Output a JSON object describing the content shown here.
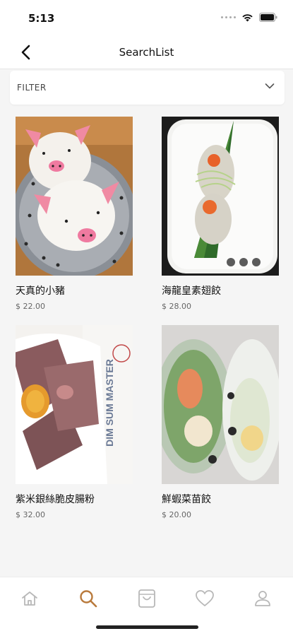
{
  "status": {
    "time": "5:13"
  },
  "header": {
    "title": "SearchList"
  },
  "filter": {
    "label": "FILTER"
  },
  "products": [
    {
      "name": "天真的小豬",
      "price": "$ 22.00"
    },
    {
      "name": "海龍皇素翅餃",
      "price": "$ 28.00"
    },
    {
      "name": "紫米銀絲脆皮腸粉",
      "price": "$ 32.00"
    },
    {
      "name": "鮮蝦菜苗餃",
      "price": "$ 20.00"
    }
  ],
  "tabs": [
    {
      "icon": "home-icon"
    },
    {
      "icon": "search-icon",
      "active": true
    },
    {
      "icon": "bag-icon"
    },
    {
      "icon": "heart-icon"
    },
    {
      "icon": "profile-icon"
    }
  ],
  "colors": {
    "accent": "#b97a3c",
    "inactive": "#b8b8b8"
  }
}
